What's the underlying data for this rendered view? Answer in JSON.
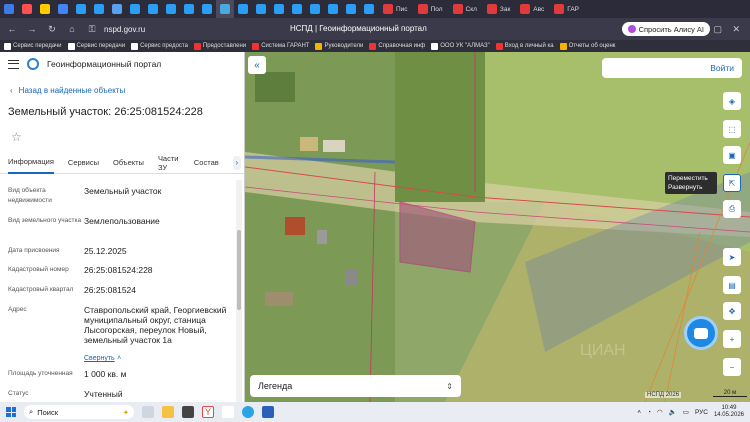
{
  "browser": {
    "url": "nspd.gov.ru",
    "page_title": "НСПД | Геоинформационный портал",
    "tabs": [
      {
        "label": "Пис"
      },
      {
        "label": "Пол"
      },
      {
        "label": "Скл"
      },
      {
        "label": "Зак"
      },
      {
        "label": "Авс"
      },
      {
        "label": "ГАР"
      }
    ],
    "alice_label": "Спросить Алису AI",
    "bookmarks": [
      "Сервис передачи",
      "Сервис передачи",
      "Сервис предоста",
      "Предоставлени",
      "Система ГАРАНТ",
      "Руководители",
      "Справочная инф",
      "ООО УК \"АЛМАЗ\"",
      "Вход в личный ка",
      "Отчеты об оценк"
    ]
  },
  "panel": {
    "app_title": "Геоинформационный портал",
    "back_label": "Назад в найденные объекты",
    "heading": "Земельный участок: 26:25:081524:228",
    "tabs": [
      "Информация",
      "Сервисы",
      "Объекты",
      "Части ЗУ",
      "Состав"
    ],
    "rows": [
      {
        "key": "Вид объекта недвижимости",
        "value": "Земельный участок"
      },
      {
        "key": "Вид земельного участка",
        "value": "Землепользование"
      },
      {
        "key": "Дата присвоения",
        "value": "25.12.2025"
      },
      {
        "key": "Кадастровый номер",
        "value": "26:25:081524:228"
      },
      {
        "key": "Кадастровый квартал",
        "value": "26:25:081524"
      },
      {
        "key": "Адрес",
        "value": "Ставропольский край, Георгиевский муниципальный округ, станица Лысогорская, переулок Новый, земельный участок 1а"
      },
      {
        "key": "Площадь уточненная",
        "value": "1 000 кв. м"
      },
      {
        "key": "Статус",
        "value": "Учтенный"
      }
    ],
    "collapse_label": "Свернуть"
  },
  "map": {
    "login_label": "Войти",
    "tooltip_line1": "Переместить",
    "tooltip_line2": "Развернуть",
    "legend_label": "Легенда",
    "credit": "НСПД 2026",
    "scale": "20 м",
    "watermark": "ЦИАН"
  },
  "taskbar": {
    "search_placeholder": "Поиск",
    "lang": "РУС",
    "time": "10:49",
    "date": "14.05.2026"
  }
}
